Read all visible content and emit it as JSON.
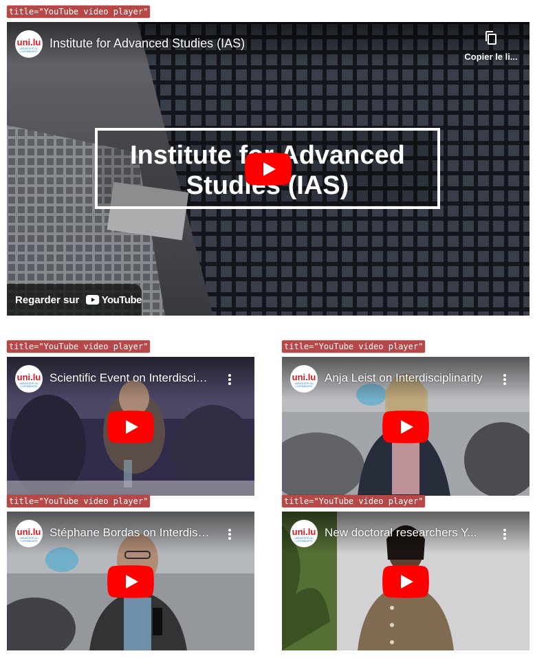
{
  "embeds": [
    {
      "tag": "title=\"YouTube video player\"",
      "title": "Institute for Advanced Studies (IAS)",
      "overlay_title_line1": "Institute for Advanced",
      "overlay_title_line2": "Studies (IAS)",
      "copy_link_label": "Copier le li...",
      "watch_label": "Regarder sur",
      "youtube_wordmark": "YouTube"
    },
    {
      "tag": "title=\"YouTube video player\"",
      "title": "Scientific Event on Interdisciplinarity"
    },
    {
      "tag": "title=\"YouTube video player\"",
      "title": "Anja Leist on Interdisciplinarity"
    },
    {
      "tag": "title=\"YouTube video player\"",
      "title": "Stéphane Bordas on Interdisciplinarity"
    },
    {
      "tag": "title=\"YouTube video player\"",
      "title": "New doctoral researchers Y..."
    }
  ],
  "channel_logo": {
    "text": "uni.lu",
    "subtext_1": "UNIVERSITÉ DU",
    "subtext_2": "LUXEMBOURG"
  },
  "colors": {
    "youtube_red": "#ff0000",
    "tag_background": "#b64848",
    "uni_red": "#d7191f",
    "uni_blue": "#1d7fc1"
  },
  "icons": [
    "play-icon",
    "copy-link-icon",
    "more-options-icon",
    "youtube-logo-icon",
    "channel-avatar-icon"
  ]
}
